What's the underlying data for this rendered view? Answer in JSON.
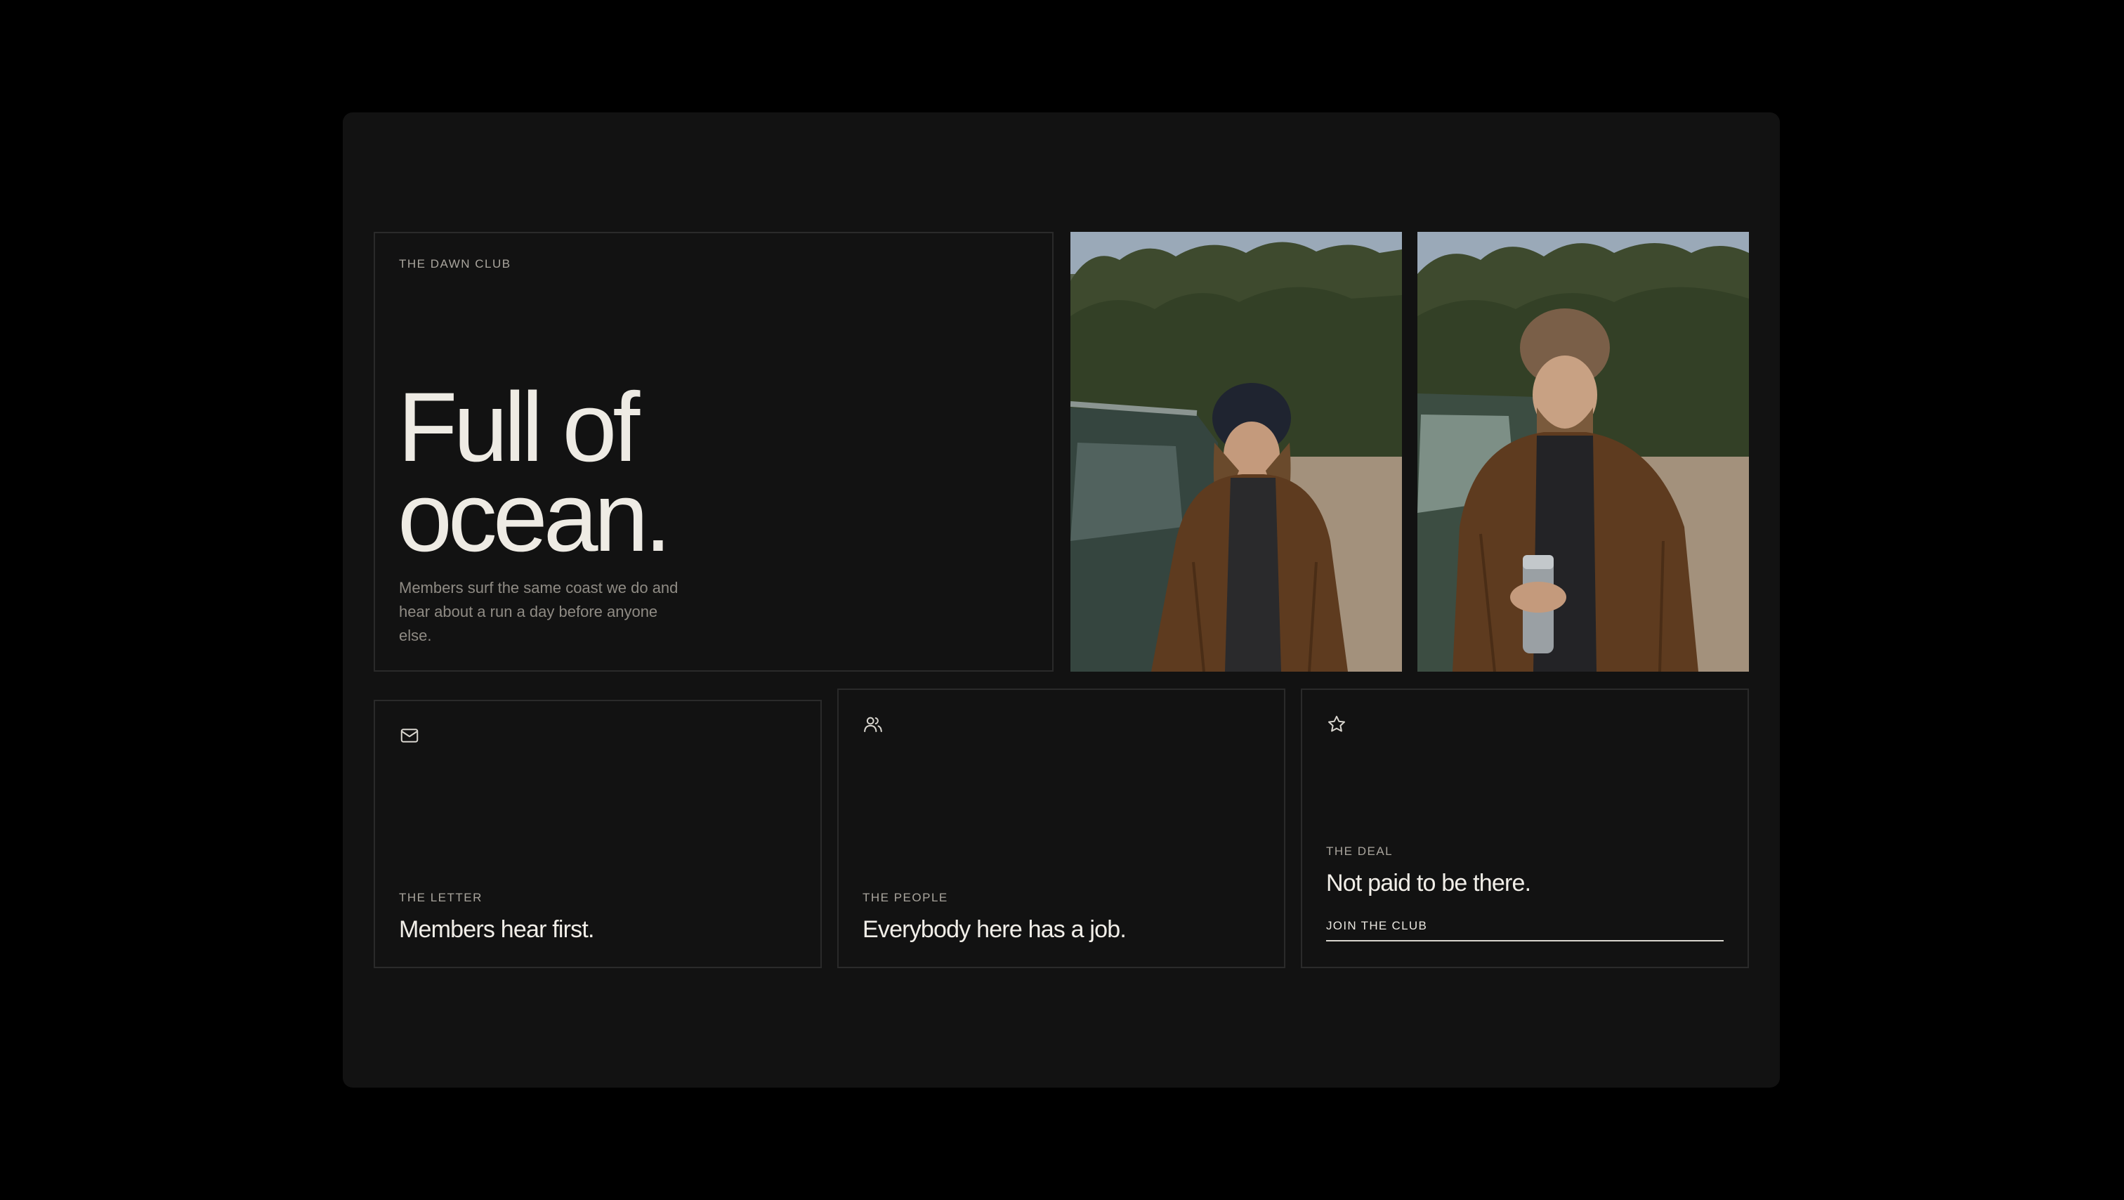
{
  "hero": {
    "eyebrow": "THE DAWN CLUB",
    "headline_line1": "Full of",
    "headline_line2": "ocean.",
    "subtext": "Members surf the same coast we do and hear about a run a day before anyone else."
  },
  "photos": [
    {
      "subject": "woman in navy beanie and brown corduroy jacket beside green station wagon"
    },
    {
      "subject": "man in brown beanie and brown corduroy jacket holding a steel thermos"
    }
  ],
  "features": [
    {
      "icon": "mail-icon",
      "eyebrow": "THE LETTER",
      "title": "Members hear first."
    },
    {
      "icon": "users-icon",
      "eyebrow": "THE PEOPLE",
      "title": "Everybody here has a job."
    },
    {
      "icon": "star-icon",
      "eyebrow": "THE DEAL",
      "title": "Not paid to be there.",
      "cta": "JOIN THE CLUB"
    }
  ],
  "colors": {
    "page_background": "#000000",
    "panel_background": "#121212",
    "card_border": "#2a2a2a",
    "headline": "#eeebe4",
    "muted_text": "#8f8b84"
  }
}
